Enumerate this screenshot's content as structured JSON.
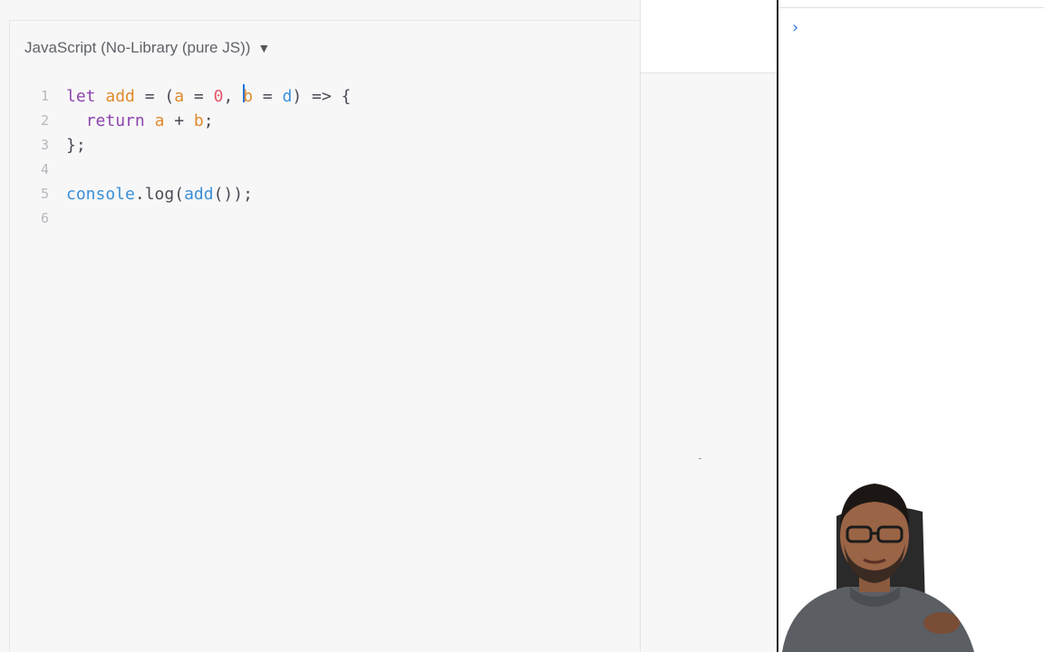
{
  "editor": {
    "language_label": "JavaScript (No-Library (pure JS))",
    "language_caret": "▼",
    "lines": [
      {
        "number": "1"
      },
      {
        "number": "2"
      },
      {
        "number": "3"
      },
      {
        "number": "4"
      },
      {
        "number": "5"
      },
      {
        "number": "6"
      }
    ],
    "code": {
      "l1": {
        "let": "let",
        "name": "add",
        "eq": " = (",
        "a": "a",
        "eq2": " = ",
        "zero": "0",
        "comma": ", ",
        "b": "b",
        "eq3": " = ",
        "d": "d",
        "close": ") => {"
      },
      "l2": {
        "ret": "return",
        "a": "a",
        "plus": " + ",
        "b": "b",
        "semi": ";"
      },
      "l3": {
        "text": "};"
      },
      "l5": {
        "console": "console",
        "dot": ".",
        "log": "log",
        "open": "(",
        "add": "add",
        "rest": "());"
      }
    }
  },
  "console": {
    "prompt": "›"
  },
  "colors": {
    "keyword": "#8e44ad",
    "identifier": "#e08a2b",
    "number": "#e4576b",
    "call": "#3b8fd6",
    "console_prompt": "#3b7bd6"
  }
}
